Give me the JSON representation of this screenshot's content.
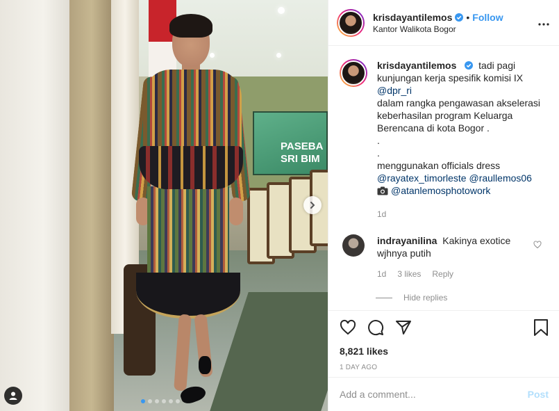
{
  "post": {
    "username": "krisdayantilemos",
    "verified_icon": "verified-badge-icon",
    "separator": "•",
    "follow_label": "Follow",
    "location": "Kantor Walikota Bogor",
    "more_icon": "more-options-icon",
    "carousel": {
      "slide_count": 6,
      "active_index": 0
    },
    "screen_text_line1": "PASEBA",
    "screen_text_line2": "SRI BIM"
  },
  "caption": {
    "username": "krisdayantilemos",
    "lines": [
      "tadi pagi",
      "kunjungan kerja spesifik komisi IX",
      "@dpr_ri",
      "dalam rangka pengawasan akselerasi",
      "keberhasilan program Keluarga",
      "Berencana di kota Bogor .",
      ".",
      ".",
      "menggunakan officials dress",
      "@rayatex_timorleste",
      "@raullemos06",
      "@atanlemosphotowork"
    ],
    "time": "1d"
  },
  "comment": {
    "username": "indrayanilina",
    "text_line1": "Kakinya exotice",
    "text_line2": "wjhnya putih",
    "time": "1d",
    "likes": "3 likes",
    "reply": "Reply",
    "hide_replies": "Hide replies"
  },
  "actions": {
    "likes": "8,821 likes",
    "date": "1 DAY AGO"
  },
  "add_comment": {
    "placeholder": "Add a comment...",
    "post_label": "Post"
  },
  "colors": {
    "accent": "#3897f0",
    "mention": "#003569",
    "muted": "#8e8e8e",
    "post_disabled": "#b2dffc"
  }
}
